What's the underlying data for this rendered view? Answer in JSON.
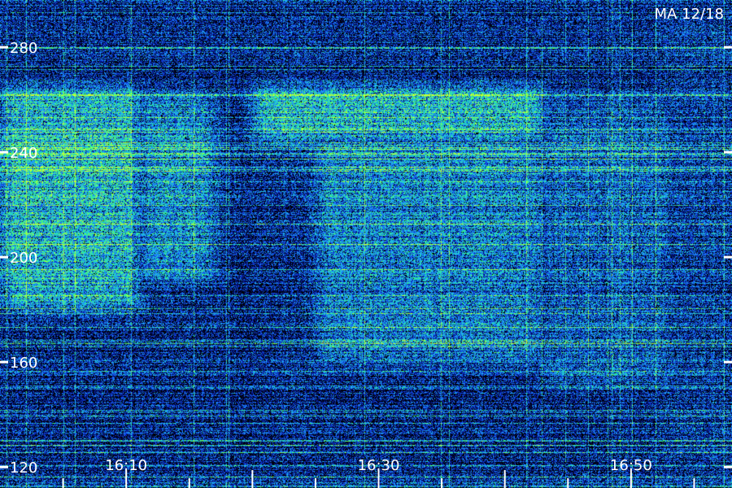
{
  "chart_data": {
    "type": "heatmap",
    "title": "MA 12/18",
    "xlabel": "",
    "ylabel": "",
    "y_ticks": [
      120,
      160,
      200,
      240,
      280
    ],
    "y_tick_labels": [
      "120",
      "160",
      "200",
      "240",
      "280"
    ],
    "ylim": [
      112,
      298
    ],
    "x_ticks": [
      "16:10",
      "16:30",
      "16:50"
    ],
    "x_range": [
      "16:00",
      "16:58"
    ],
    "grid": false,
    "legend": "none",
    "colormap": [
      "#000000",
      "#00107a",
      "#1440e6",
      "#1ea0ff",
      "#20d8c8",
      "#40ff70",
      "#d0ff30"
    ],
    "intensity_regions": [
      {
        "t_start": "16:00",
        "t_end": "16:11",
        "y_min": 180,
        "y_max": 265,
        "level": 0.85
      },
      {
        "t_start": "16:11",
        "t_end": "16:17",
        "y_min": 190,
        "y_max": 262,
        "level": 0.6
      },
      {
        "t_start": "16:20",
        "t_end": "16:43",
        "y_min": 245,
        "y_max": 265,
        "level": 0.9
      },
      {
        "t_start": "16:25",
        "t_end": "16:43",
        "y_min": 160,
        "y_max": 245,
        "level": 0.55
      },
      {
        "t_start": "16:43",
        "t_end": "16:53",
        "y_min": 150,
        "y_max": 260,
        "level": 0.35
      },
      {
        "t_start": "16:53",
        "t_end": "16:58",
        "y_min": 120,
        "y_max": 290,
        "level": 0.15
      }
    ]
  }
}
